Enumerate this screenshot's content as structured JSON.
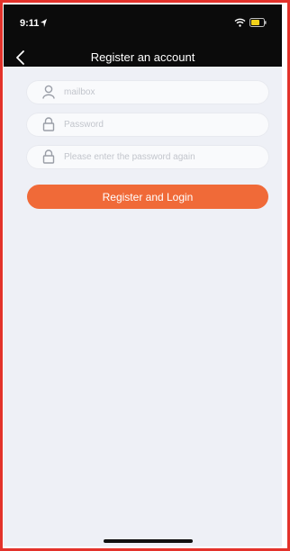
{
  "status_bar": {
    "time": "9:11",
    "icons": [
      "location-arrow-icon",
      "wifi-icon",
      "battery-icon"
    ]
  },
  "nav": {
    "back_icon": "chevron-left-icon",
    "title": "Register an account"
  },
  "form": {
    "mailbox_placeholder": "mailbox",
    "password_placeholder": "Password",
    "confirm_placeholder": "Please enter the password again",
    "submit_label": "Register and Login"
  },
  "colors": {
    "accent": "#f06a38",
    "header_bg": "#0b0b0b",
    "page_bg": "#eef0f6",
    "frame_border": "#e3322b"
  }
}
